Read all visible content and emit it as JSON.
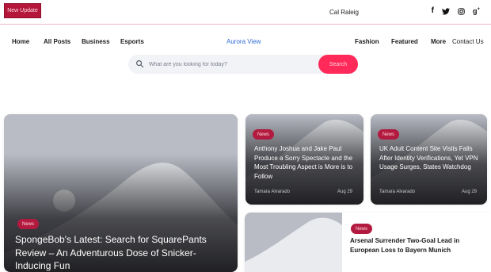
{
  "topbar": {
    "badge": "New Update",
    "author": "Cal Raleig",
    "socials": [
      "facebook-icon",
      "twitter-icon",
      "instagram-icon",
      "google-plus-icon"
    ]
  },
  "nav": {
    "items": [
      "Home",
      "All Posts",
      "Business",
      "Esports",
      "Fashion",
      "Featured",
      "More",
      "Contact Us"
    ],
    "brand": "Aurora View"
  },
  "search": {
    "placeholder": "What are you looking for today?",
    "button": "Search"
  },
  "colors": {
    "accent": "#ff2a5a",
    "tag": "#b31a3f",
    "brand_link": "#2d6bd9",
    "placeholder_bg": "#b9bcc5"
  },
  "featured": {
    "tag": "News",
    "title": "SpongeBob's Latest: Search for SquarePants Review – An Adventurous Dose of Snicker-Inducing Fun"
  },
  "cards": [
    {
      "tag": "News",
      "title": "Anthony Joshua and Jake Paul Produce a Sorry Spectacle and the Most Troubling Aspect is More is to Follow",
      "author": "Tamara Alvarado",
      "date": "Aug 29"
    },
    {
      "tag": "News",
      "title": "UK Adult Content Site Visits Falls After Identity Verifications, Yet VPN Usage Surges, States Watchdog",
      "author": "Tamara Alvarado",
      "date": "Aug 29"
    }
  ],
  "wide_card": {
    "tag": "News",
    "title": "Arsenal Surrender Two-Goal Lead in European Loss to Bayern Munich"
  }
}
